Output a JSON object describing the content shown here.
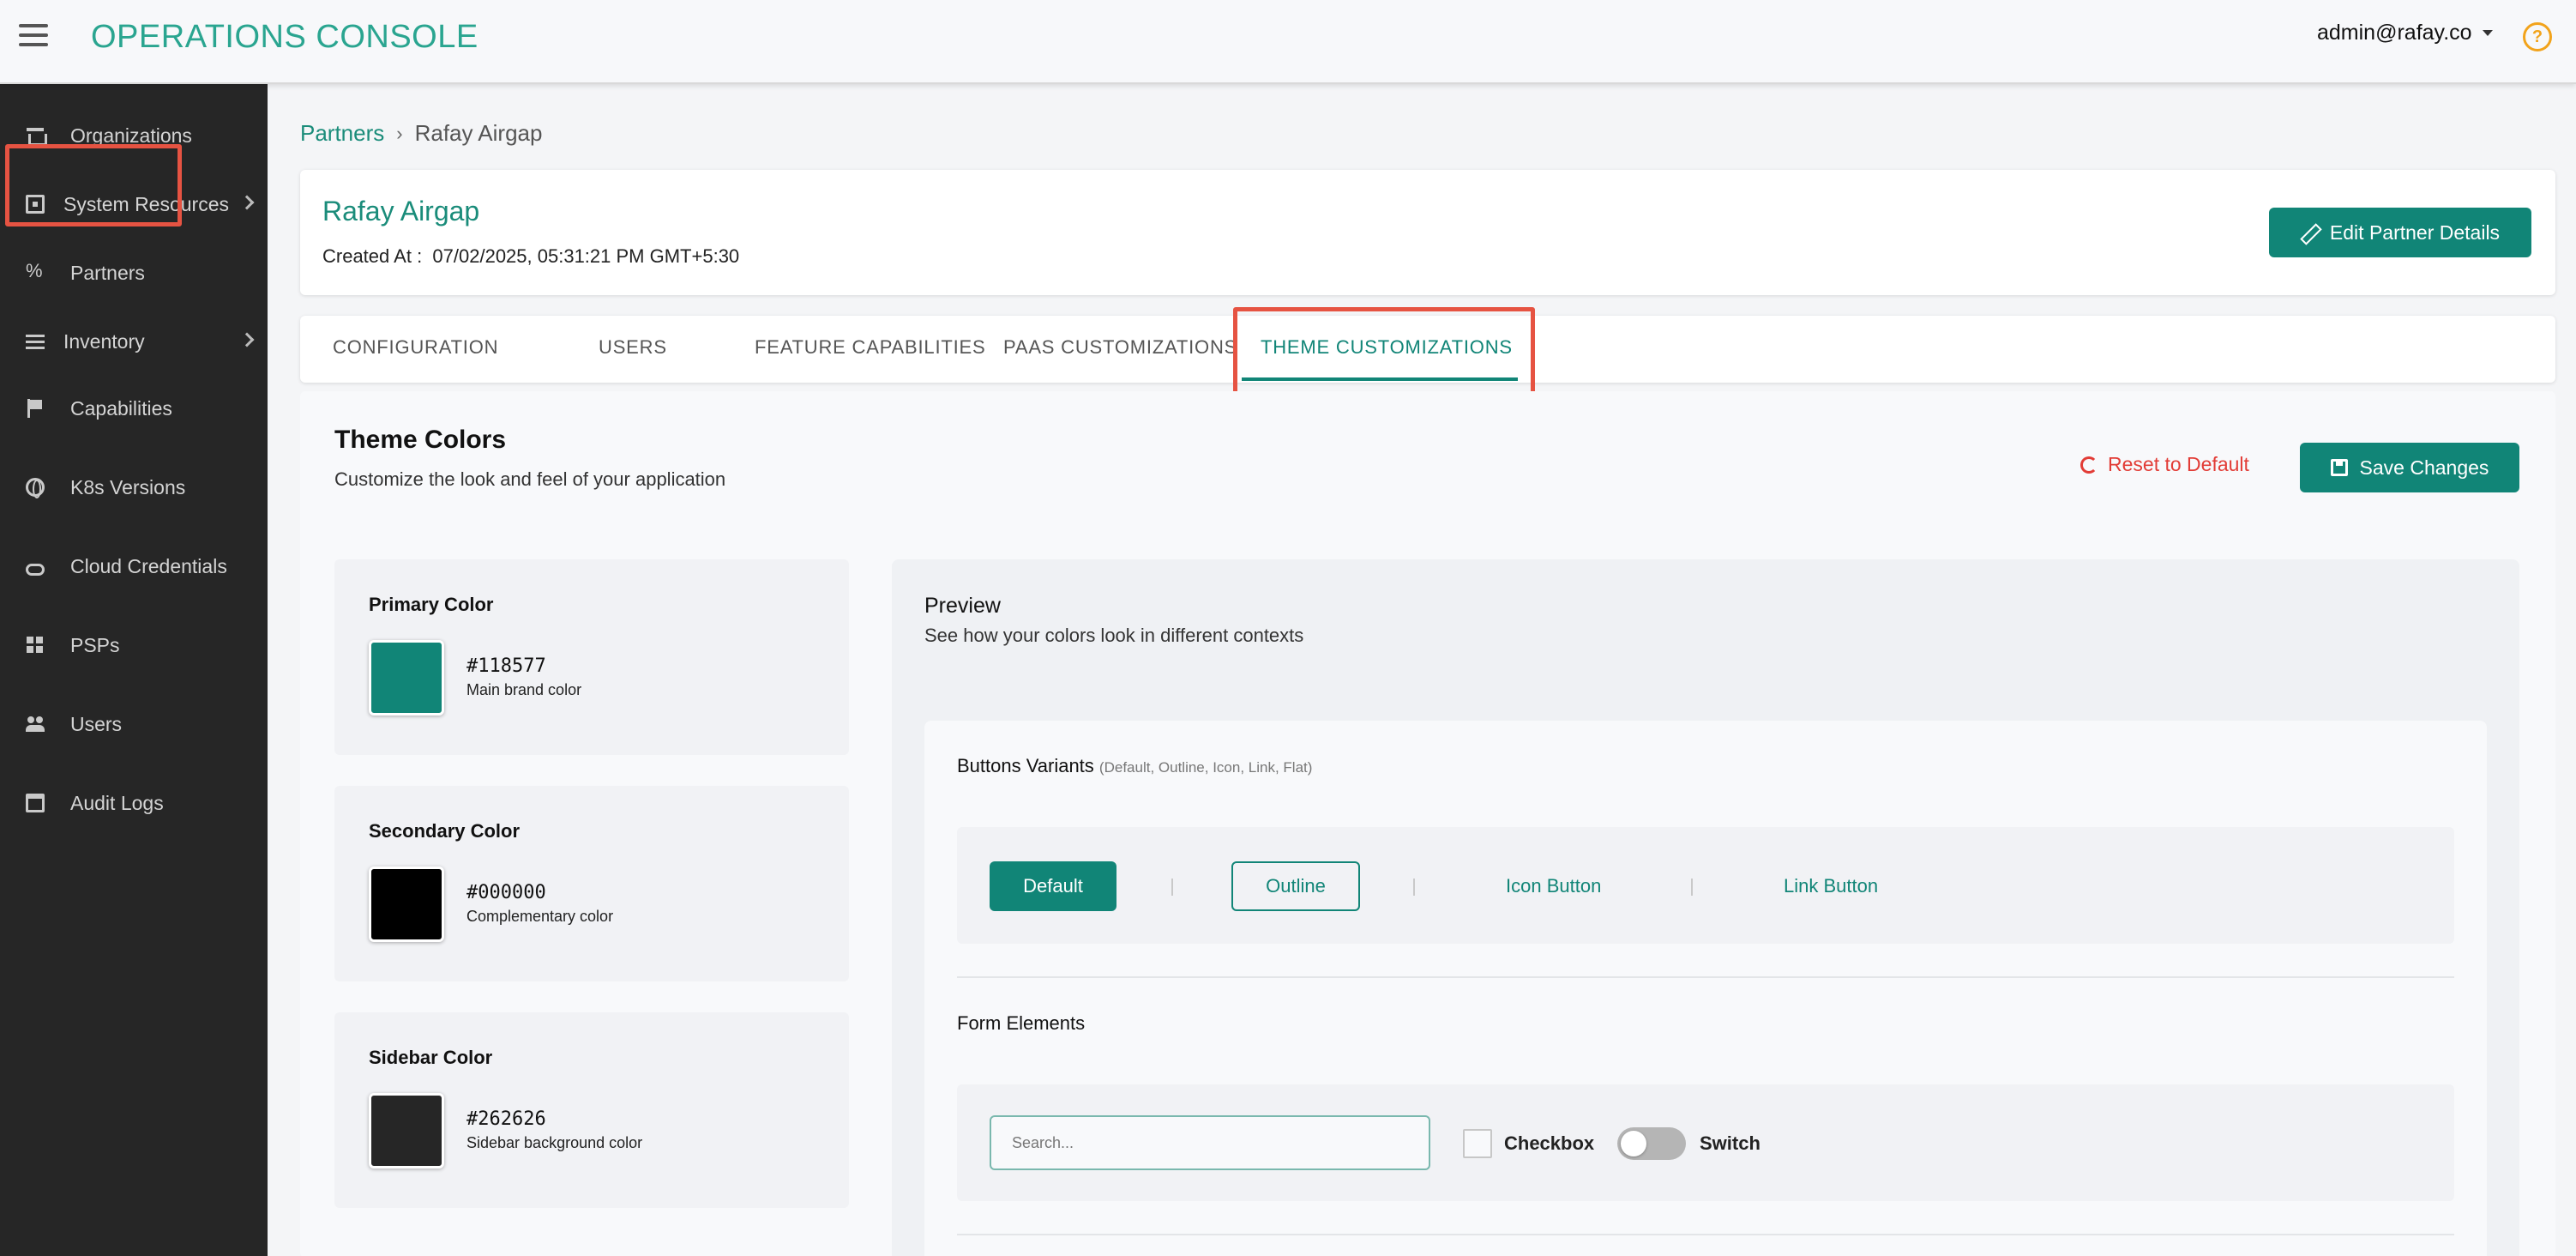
{
  "header": {
    "title": "OPERATIONS CONSOLE",
    "user": "admin@rafay.co"
  },
  "sidebar": {
    "items": [
      {
        "label": "Organizations",
        "icon": "bank-icon"
      },
      {
        "label": "System Resources",
        "icon": "chip-icon"
      },
      {
        "label": "Partners",
        "icon": "percent-icon"
      },
      {
        "label": "Inventory",
        "icon": "list-icon"
      },
      {
        "label": "Capabilities",
        "icon": "flag-icon"
      },
      {
        "label": "K8s Versions",
        "icon": "globe-icon"
      },
      {
        "label": "Cloud Credentials",
        "icon": "cloud-icon"
      },
      {
        "label": "PSPs",
        "icon": "grid-icon"
      },
      {
        "label": "Users",
        "icon": "people-icon"
      },
      {
        "label": "Audit Logs",
        "icon": "calendar-icon"
      }
    ]
  },
  "breadcrumb": {
    "parent": "Partners",
    "separator": "›",
    "current": "Rafay Airgap"
  },
  "partner": {
    "name": "Rafay Airgap",
    "created_label": "Created At :",
    "created_value": "07/02/2025, 05:31:21 PM GMT+5:30",
    "edit_label": "Edit Partner Details"
  },
  "tabs": [
    {
      "label": "CONFIGURATION"
    },
    {
      "label": "USERS"
    },
    {
      "label": "FEATURE CAPABILITIES"
    },
    {
      "label": "PAAS CUSTOMIZATIONS"
    },
    {
      "label": "THEME CUSTOMIZATIONS"
    }
  ],
  "theme": {
    "title": "Theme Colors",
    "subtitle": "Customize the look and feel of your application",
    "reset_label": "Reset to Default",
    "save_label": "Save Changes",
    "colors": [
      {
        "label": "Primary Color",
        "hex": "#118577",
        "desc": "Main brand color"
      },
      {
        "label": "Secondary Color",
        "hex": "#000000",
        "desc": "Complementary color"
      },
      {
        "label": "Sidebar Color",
        "hex": "#262626",
        "desc": "Sidebar background color"
      }
    ]
  },
  "preview": {
    "title": "Preview",
    "subtitle": "See how your colors look in different contexts",
    "buttons_title": "Buttons Variants",
    "buttons_note": "(Default, Outline, Icon, Link, Flat)",
    "btn_default": "Default",
    "btn_outline": "Outline",
    "btn_icon": "Icon Button",
    "btn_link": "Link Button",
    "form_title": "Form Elements",
    "search_placeholder": "Search...",
    "checkbox_label": "Checkbox",
    "switch_label": "Switch"
  },
  "colors": {
    "primary": "#118577",
    "accent_light": "#2aa590",
    "danger": "#e23c36",
    "highlight": "#e65342"
  }
}
